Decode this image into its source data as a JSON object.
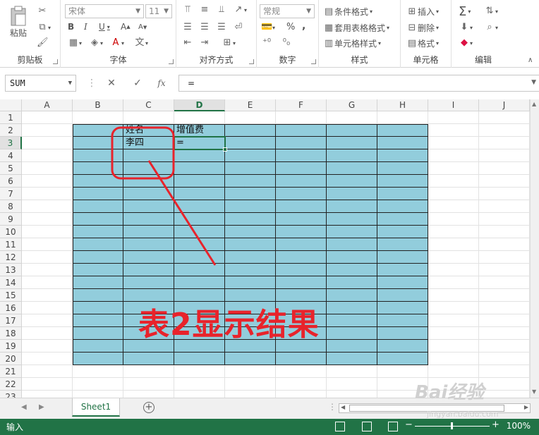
{
  "ribbon": {
    "clipboard": {
      "paste": "粘贴",
      "label": "剪贴板"
    },
    "font": {
      "name": "宋体",
      "size": "11",
      "bold": "B",
      "italic": "I",
      "underline": "U",
      "grow": "A",
      "shrink": "A",
      "label": "字体"
    },
    "alignment": {
      "label": "对齐方式"
    },
    "number": {
      "format": "常规",
      "percent": "%",
      "comma": ",",
      "label": "数字"
    },
    "styles": {
      "conditional": "条件格式",
      "table": "套用表格格式",
      "cell": "单元格样式",
      "label": "样式"
    },
    "cells": {
      "insert": "插入",
      "delete": "删除",
      "format": "格式",
      "label": "单元格"
    },
    "editing": {
      "label": "编辑"
    }
  },
  "formula_bar": {
    "name_box": "SUM",
    "fx": "fx",
    "formula": "="
  },
  "grid": {
    "columns": [
      "A",
      "B",
      "C",
      "D",
      "E",
      "F",
      "G",
      "H",
      "I",
      "J"
    ],
    "rows": [
      "1",
      "2",
      "3",
      "4",
      "5",
      "6",
      "7",
      "8",
      "9",
      "10",
      "11",
      "12",
      "13",
      "14",
      "15",
      "16",
      "17",
      "18",
      "19",
      "20",
      "21",
      "22",
      "23"
    ],
    "active_column": "D",
    "active_row": "3",
    "cells": {
      "C2": "姓名",
      "D2": "增值费",
      "C3": "李四",
      "D3": "="
    }
  },
  "annotation": {
    "text": "表2显示结果",
    "color": "#e8232b"
  },
  "sheet_tabs": {
    "active": "Sheet1",
    "add": "+"
  },
  "status": {
    "mode": "输入",
    "zoom": "100%"
  },
  "watermark": {
    "brand": "Bai经验",
    "url": "jingyan.baidu.com"
  },
  "colors": {
    "accent": "#217346",
    "table_fill": "#92cddc"
  }
}
